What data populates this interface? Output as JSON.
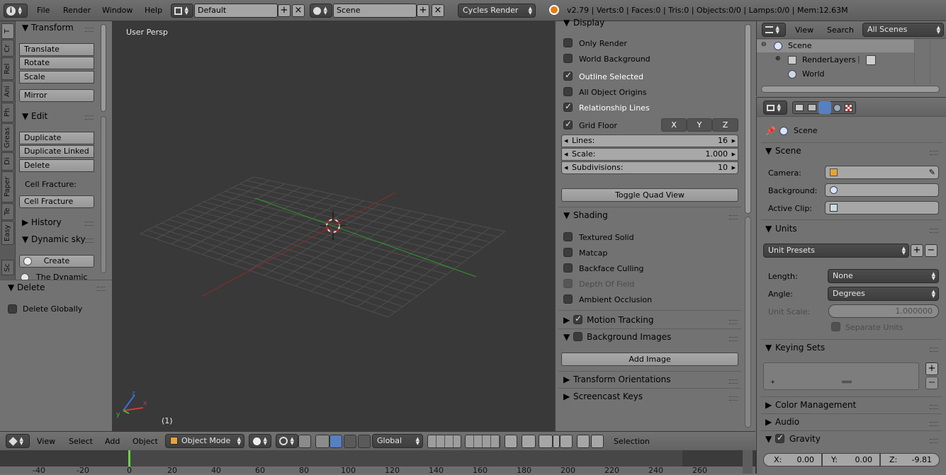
{
  "topbar": {
    "menus": [
      "File",
      "Render",
      "Window",
      "Help"
    ],
    "screen_layout": "Default",
    "scene": "Scene",
    "render_engine": "Cycles Render",
    "stats": "v2.79 | Verts:0 | Faces:0 | Tris:0 | Objects:0/0 | Lamps:0/0 | Mem:12.63M"
  },
  "toolshelf": {
    "tabs": [
      "T",
      "Cr",
      "Rel",
      "Ani",
      "Ph",
      "Greas",
      "Di",
      "Paper",
      "Te",
      "Easy",
      "Sc"
    ],
    "transform_title": "Transform",
    "transform_buttons": [
      "Translate",
      "Rotate",
      "Scale"
    ],
    "mirror": "Mirror",
    "edit_title": "Edit",
    "edit_buttons": [
      "Duplicate",
      "Duplicate Linked",
      "Delete"
    ],
    "cell_fracture_label": "Cell Fracture:",
    "cell_fracture_button": "Cell Fracture",
    "history_title": "History",
    "dynamic_sky_title": "Dynamic sky",
    "create_button": "Create",
    "cutoff_text": "The Dynamic"
  },
  "redo_panel": {
    "title": "Delete",
    "delete_globally": "Delete Globally"
  },
  "viewport": {
    "view_name": "User Persp",
    "frame": "(1)"
  },
  "npanel": {
    "display_title": "Display",
    "only_render": "Only Render",
    "world_background": "World Background",
    "outline_selected": "Outline Selected",
    "all_object_origins": "All Object Origins",
    "relationship_lines": "Relationship Lines",
    "grid_floor": "Grid Floor",
    "axes": [
      "X",
      "Y",
      "Z"
    ],
    "lines_label": "Lines:",
    "lines_value": "16",
    "scale_label": "Scale:",
    "scale_value": "1.000",
    "subdivisions_label": "Subdivisions:",
    "subdivisions_value": "10",
    "toggle_quad_view": "Toggle Quad View",
    "shading_title": "Shading",
    "textured_solid": "Textured Solid",
    "matcap": "Matcap",
    "backface_culling": "Backface Culling",
    "depth_of_field": "Depth Of Field",
    "ambient_occlusion": "Ambient Occlusion",
    "motion_tracking": "Motion Tracking",
    "background_images": "Background Images",
    "add_image": "Add Image",
    "transform_orientations": "Transform Orientations",
    "screencast_keys": "Screencast Keys"
  },
  "outliner": {
    "view": "View",
    "search": "Search",
    "filter": "All Scenes",
    "scene": "Scene",
    "render_layers": "RenderLayers",
    "world": "World"
  },
  "properties": {
    "breadcrumb": "Scene",
    "scene_title": "Scene",
    "camera_label": "Camera:",
    "background_label": "Background:",
    "active_clip_label": "Active Clip:",
    "units_title": "Units",
    "unit_presets": "Unit Presets",
    "length_label": "Length:",
    "length_value": "None",
    "angle_label": "Angle:",
    "angle_value": "Degrees",
    "unit_scale_label": "Unit Scale:",
    "unit_scale_value": "1.000000",
    "separate_units": "Separate Units",
    "keying_sets_title": "Keying Sets",
    "color_management_title": "Color Management",
    "audio_title": "Audio",
    "gravity_title": "Gravity",
    "gravity_x_label": "X:",
    "gravity_x": "0.00",
    "gravity_y_label": "Y:",
    "gravity_y": "0.00",
    "gravity_z_label": "Z:",
    "gravity_z": "-9.81"
  },
  "view_header": {
    "menus": [
      "View",
      "Select",
      "Add",
      "Object"
    ],
    "mode": "Object Mode",
    "orientation": "Global",
    "selection": "Selection"
  },
  "timeline": {
    "ticks": [
      "-40",
      "-20",
      "0",
      "20",
      "40",
      "60",
      "80",
      "100",
      "120",
      "140",
      "160",
      "180",
      "200",
      "220",
      "240",
      "260"
    ]
  }
}
